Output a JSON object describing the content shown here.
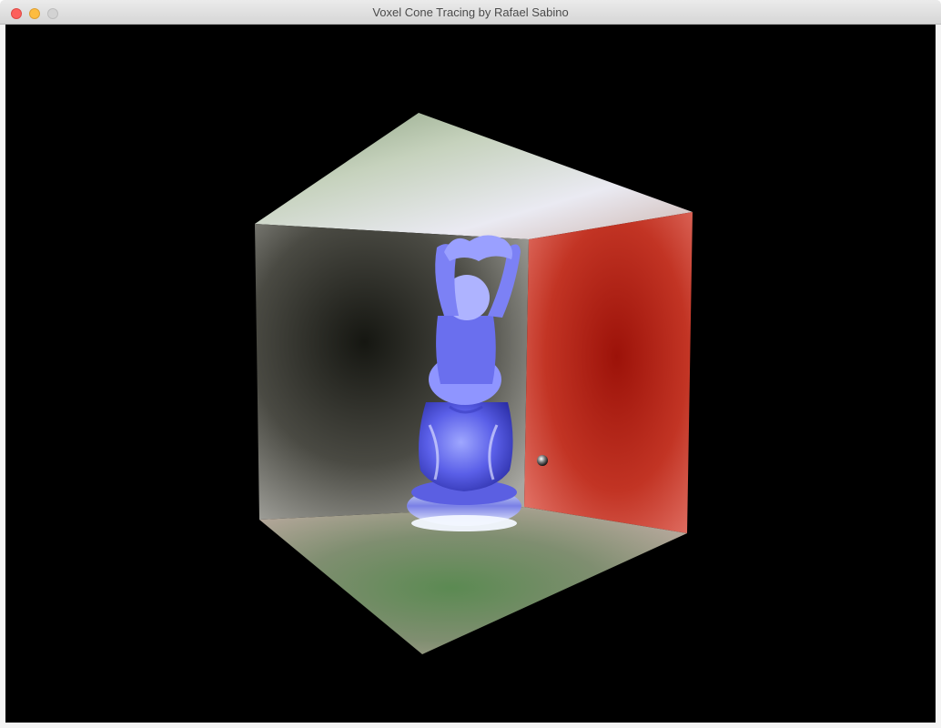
{
  "window": {
    "title": "Voxel Cone Tracing by Rafael Sabino",
    "buttons": {
      "close": "close-button",
      "minimize": "minimize-button",
      "zoom": "zoom-button"
    }
  },
  "scene": {
    "description_colors": {
      "background": "#000000",
      "left_wall": "#8c8c86",
      "right_wall": "#c8281e",
      "ceiling": "#d8e0d4",
      "floor": "#5f8a58",
      "statue": "#6f73f0"
    },
    "icons": {
      "statue": "buddha-statue-icon",
      "sphere": "sphere-icon"
    }
  }
}
